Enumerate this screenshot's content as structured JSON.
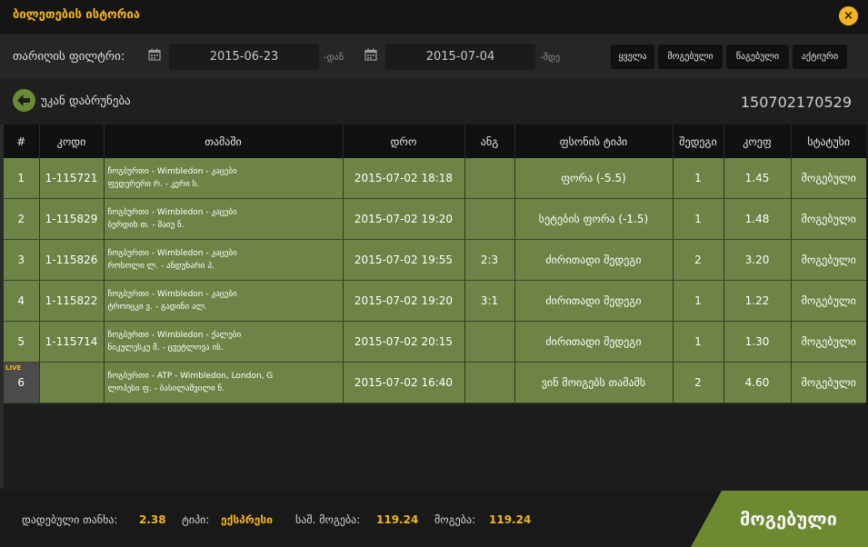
{
  "window": {
    "title": "ბილეთების ისტორია",
    "close_icon": "×"
  },
  "filter": {
    "label": "თარიღის ფილტრი:",
    "date_from": "2015-06-23",
    "from_suffix": "-დან",
    "date_to": "2015-07-04",
    "to_suffix": "-მდე",
    "buttons": [
      "ყველა",
      "მოგებული",
      "წაგებული",
      "აქტიური"
    ]
  },
  "back": {
    "label": "უკან დაბრუნება",
    "ticket_id": "150702170529"
  },
  "table": {
    "headers": [
      "#",
      "კოდი",
      "თამაში",
      "დრო",
      "ანგ",
      "ფსონის ტიპი",
      "შედეგი",
      "კოეფ",
      "სტატუსი"
    ],
    "rows": [
      {
        "num": "1",
        "live": "",
        "code": "1-115721",
        "game_line1": "ჩოგბურთი - Wimbledon - კაცები",
        "game_line2": "ფედერერი რ. - კერი ს.",
        "time": "2015-07-02 18:18",
        "score": "",
        "bet_type": "ფორა (-5.5)",
        "result": "1",
        "odds": "1.45",
        "status": "მოგებული"
      },
      {
        "num": "2",
        "live": "",
        "code": "1-115829",
        "game_line1": "ჩოგბურთი - Wimbledon - კაცები",
        "game_line2": "ბერდიხ თ. - მაიუ ნ.",
        "time": "2015-07-02 19:20",
        "score": "",
        "bet_type": "სეტების ფორა (-1.5)",
        "result": "1",
        "odds": "1.48",
        "status": "მოგებული"
      },
      {
        "num": "3",
        "live": "",
        "code": "1-115826",
        "game_line1": "ჩოგბურთი - Wimbledon - კაცები",
        "game_line2": "როსოლი ლ. - ანდუხარი პ.",
        "time": "2015-07-02 19:55",
        "score": "2:3",
        "bet_type": "ძირითადი შედეგი",
        "result": "2",
        "odds": "3.20",
        "status": "მოგებული"
      },
      {
        "num": "4",
        "live": "",
        "code": "1-115822",
        "game_line1": "ჩოგბურთი - Wimbledon - კაცები",
        "game_line2": "ტროიცკი ვ. - გადინი ალ.",
        "time": "2015-07-02 19:20",
        "score": "3:1",
        "bet_type": "ძირითადი შედეგი",
        "result": "1",
        "odds": "1.22",
        "status": "მოგებული"
      },
      {
        "num": "5",
        "live": "",
        "code": "1-115714",
        "game_line1": "ჩოგბურთი - Wimbledon - ქალები",
        "game_line2": "ნიკულესკუ მ. - ცვეტლოვა ის.",
        "time": "2015-07-02 20:15",
        "score": "",
        "bet_type": "ძირითადი შედეგი",
        "result": "1",
        "odds": "1.30",
        "status": "მოგებული"
      },
      {
        "num": "6",
        "live": "LIVE",
        "code": "",
        "game_line1": "ჩოგბურთი - ATP - Wimbledon, London, G",
        "game_line2": "ლოპესი ფ. - ბასილაშვილი ნ.",
        "time": "2015-07-02 16:40",
        "score": "",
        "bet_type": "ვინ მოიგებს თამაშს",
        "result": "2",
        "odds": "4.60",
        "status": "მოგებული"
      }
    ]
  },
  "summary": {
    "stake_label": "დადებული თანხა:",
    "stake": "2.38",
    "type_label": "ტიპი:",
    "type": "ექსპრესი",
    "possible_label": "საშ. მოგება:",
    "possible": "119.24",
    "win_label": "მოგება:",
    "win": "119.24",
    "status": "მოგებული"
  },
  "colors": {
    "accent": "#f3b41f",
    "row_green": "#6d8446",
    "status_green": "#6d8a31",
    "back_icon": "#6b8b34"
  },
  "icons": [
    "close-icon",
    "calendar-icon",
    "arrow-left-icon"
  ]
}
